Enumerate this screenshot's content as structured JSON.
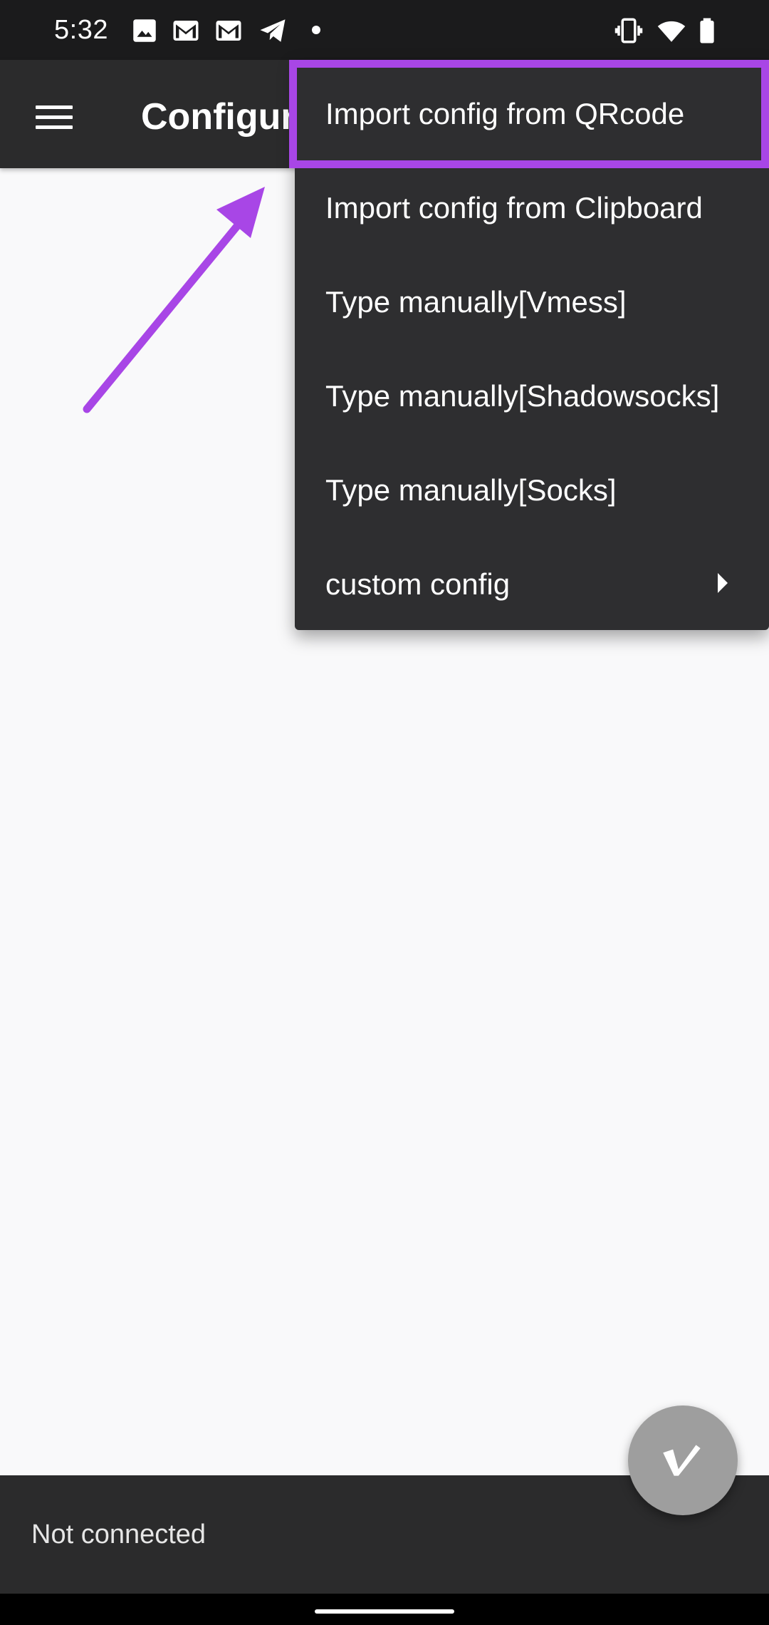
{
  "status_bar": {
    "time": "5:32",
    "left_icons": [
      "image-icon",
      "gmail-icon",
      "gmail-icon",
      "telegram-icon",
      "dot-icon"
    ],
    "right_icons": [
      "vibrate-icon",
      "wifi-icon",
      "battery-icon"
    ]
  },
  "toolbar": {
    "title": "Configuration file"
  },
  "menu": {
    "items": [
      {
        "label": "Import config from QRcode"
      },
      {
        "label": "Import config from Clipboard"
      },
      {
        "label": "Type manually[Vmess]"
      },
      {
        "label": "Type manually[Shadowsocks]"
      },
      {
        "label": "Type manually[Socks]"
      },
      {
        "label": "custom config",
        "has_submenu": true
      }
    ]
  },
  "annotation": {
    "color": "#a846e6"
  },
  "bottom": {
    "status": "Not connected"
  },
  "fab": {
    "icon": "v-logo-icon"
  }
}
